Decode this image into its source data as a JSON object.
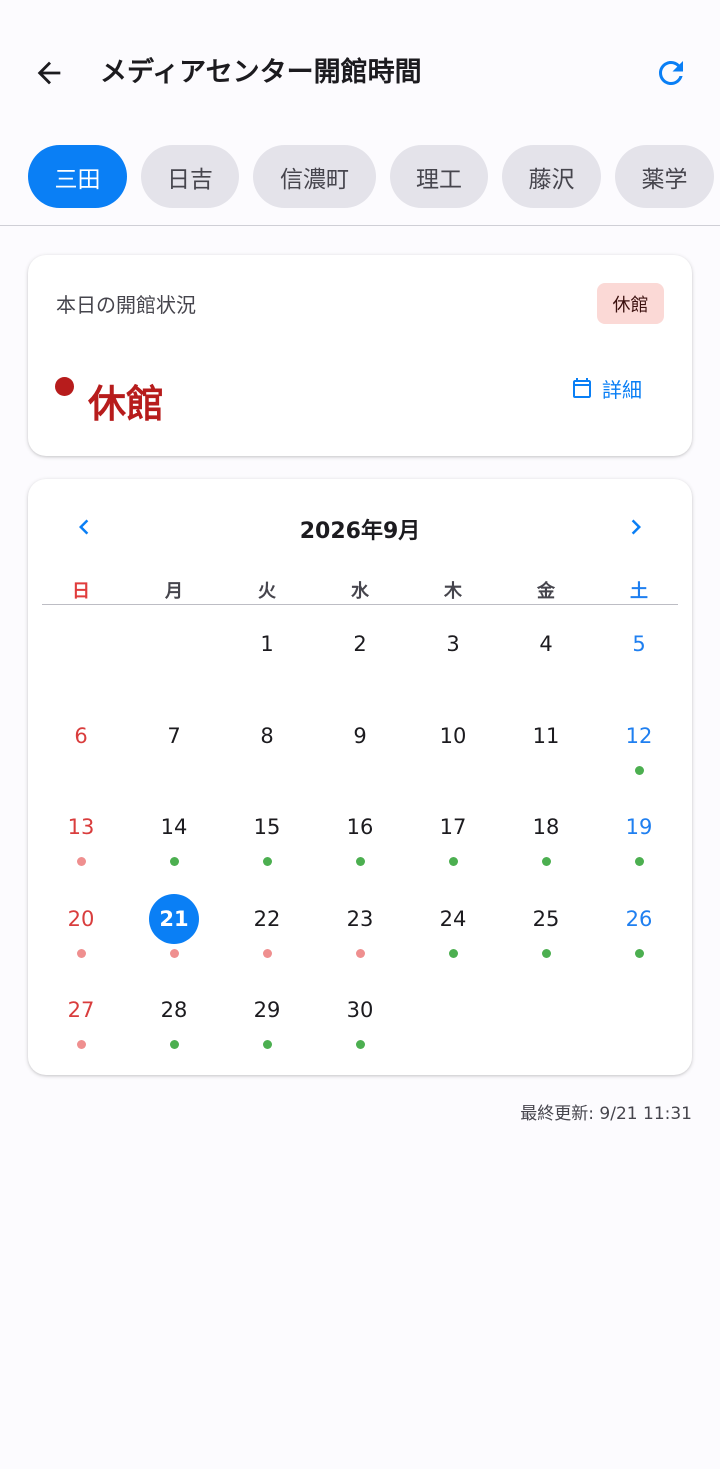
{
  "appbar": {
    "title": "メディアセンター開館時間",
    "back_icon": "arrow-left-icon",
    "refresh_icon": "refresh-icon"
  },
  "campuses": [
    {
      "label": "三田",
      "active": true
    },
    {
      "label": "日吉",
      "active": false
    },
    {
      "label": "信濃町",
      "active": false
    },
    {
      "label": "理工",
      "active": false
    },
    {
      "label": "藤沢",
      "active": false
    },
    {
      "label": "薬学",
      "active": false
    }
  ],
  "status": {
    "label": "本日の開館状況",
    "badge": "休館",
    "state": "休館",
    "detail_label": "詳細",
    "detail_icon": "calendar-icon"
  },
  "calendar": {
    "month_title": "2026年9月",
    "weekdays": [
      "日",
      "月",
      "火",
      "水",
      "木",
      "金",
      "土"
    ],
    "first_weekday": 2,
    "days_in_month": 30,
    "selected_day": 21,
    "markers": {
      "12": "open",
      "13": "closed",
      "14": "open",
      "15": "open",
      "16": "open",
      "17": "open",
      "18": "open",
      "19": "open",
      "20": "closed",
      "21": "closed",
      "22": "closed",
      "23": "closed",
      "24": "open",
      "25": "open",
      "26": "open",
      "27": "closed",
      "28": "open",
      "29": "open",
      "30": "open"
    }
  },
  "footer": {
    "last_updated": "最終更新: 9/21 11:31"
  },
  "colors": {
    "accent": "#0a7ff5",
    "closed_red": "#b71c1c",
    "open_dot": "#4caf50",
    "closed_dot": "#ef8f8f"
  }
}
